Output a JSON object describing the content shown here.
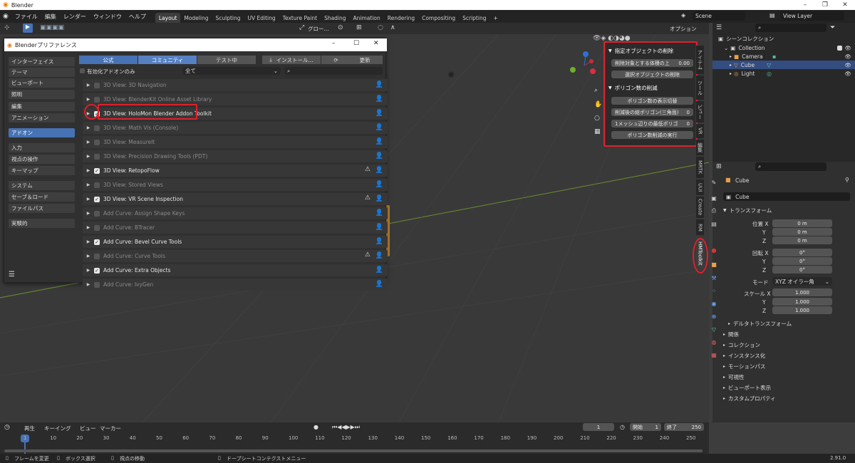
{
  "window": {
    "title": "Blender",
    "min": "–",
    "max": "❐",
    "close": "✕"
  },
  "menu": [
    "ファイル",
    "編集",
    "レンダー",
    "ウィンドウ",
    "ヘルプ"
  ],
  "workspaces": [
    "Layout",
    "Modeling",
    "Sculpting",
    "UV Editing",
    "Texture Paint",
    "Shading",
    "Animation",
    "Rendering",
    "Compositing",
    "Scripting",
    "+"
  ],
  "scene": "Scene",
  "view_layer": "View Layer",
  "toolbar": {
    "orientation": "グロー...",
    "options": "オプション"
  },
  "prefs": {
    "title": "Blenderプリファレンス",
    "nav": [
      "インターフェイス",
      "テーマ",
      "ビューポート",
      "照明",
      "編集",
      "アニメーション",
      "アドオン",
      "入力",
      "視点の操作",
      "キーマップ",
      "システム",
      "セーブ＆ロード",
      "ファイルパス",
      "実験的"
    ],
    "tabs": [
      "公式",
      "コミュニティ",
      "テスト中",
      "インストール...",
      "更新"
    ],
    "enabled_only": "有効化アドオンのみ",
    "category": "全て",
    "addons": [
      {
        "name": "3D View: 3D Navigation",
        "on": false
      },
      {
        "name": "3D View: BlenderKit Online Asset Library",
        "on": false
      },
      {
        "name": "3D View: HoloMon Blender Addon Toolkit",
        "on": true
      },
      {
        "name": "3D View: Math Vis (Console)",
        "on": false
      },
      {
        "name": "3D View: MeasureIt",
        "on": false
      },
      {
        "name": "3D View: Precision Drawing Tools (PDT)",
        "on": false
      },
      {
        "name": "3D View: RetopoFlow",
        "on": true
      },
      {
        "name": "3D View: Stored Views",
        "on": false
      },
      {
        "name": "3D View: VR Scene Inspection",
        "on": true
      },
      {
        "name": "Add Curve: Assign Shape Keys",
        "on": false
      },
      {
        "name": "Add Curve: BTracer",
        "on": false
      },
      {
        "name": "Add Curve: Bevel Curve Tools",
        "on": true
      },
      {
        "name": "Add Curve: Curve Tools",
        "on": false
      },
      {
        "name": "Add Curve: Extra Objects",
        "on": true
      },
      {
        "name": "Add Curve: IvyGen",
        "on": false
      }
    ]
  },
  "npanel": {
    "sec1": "指定オブジェクトの削除",
    "b1": "削除対象とする体積の上",
    "b1_val": "0.00",
    "b2": "選択オブジェクトの削除",
    "sec2": "ポリゴン数の削減",
    "b3": "ポリゴン数の表示切替",
    "b4": "削減後の総ポリゴン(三角面)",
    "b4_val": "0",
    "b5": "1メッシュ辺りの最低ポリゴ",
    "b5_val": "0",
    "b6": "ポリゴン数削減の実行"
  },
  "side_tabs": [
    "アイテム",
    "ツール",
    "ビュー",
    "VR",
    "編集",
    "MRTK",
    "UUI",
    "Create",
    "RM",
    "HMToolkit"
  ],
  "outliner": {
    "root": "シーンコレクション",
    "collection": "Collection",
    "camera": "Camera",
    "cube": "Cube",
    "light": "Light"
  },
  "props": {
    "object": "Cube",
    "object_field": "Cube",
    "transform": "トランスフォーム",
    "loc": "位置 X",
    "y": "Y",
    "z": "Z",
    "loc_vals": [
      "0 m",
      "0 m",
      "0 m"
    ],
    "rot": "回転 X",
    "rot_vals": [
      "0°",
      "0°",
      "0°"
    ],
    "mode": "モード",
    "mode_val": "XYZ オイラー角",
    "scale": "スケール X",
    "scale_vals": [
      "1.000",
      "1.000",
      "1.000"
    ],
    "delta": "デルタトランスフォーム",
    "sections": [
      "関係",
      "コレクション",
      "インスタンス化",
      "モーションパス",
      "可視性",
      "ビューポート表示",
      "カスタムプロパティ"
    ]
  },
  "timeline": {
    "menu": [
      "再生",
      "キーイング",
      "ビュー",
      "マーカー"
    ],
    "current": "1",
    "start_label": "開始",
    "start": "1",
    "end_label": "終了",
    "end": "250",
    "ticks": [
      "1",
      "10",
      "20",
      "30",
      "40",
      "50",
      "60",
      "70",
      "80",
      "90",
      "100",
      "110",
      "120",
      "130",
      "140",
      "150",
      "160",
      "170",
      "180",
      "190",
      "200",
      "210",
      "220",
      "230",
      "240",
      "250"
    ]
  },
  "status": {
    "a": "フレームを変更",
    "b": "ボックス選択",
    "c": "視点の移動",
    "d": "ドープシートコンテクストメニュー",
    "version": "2.91.0"
  }
}
